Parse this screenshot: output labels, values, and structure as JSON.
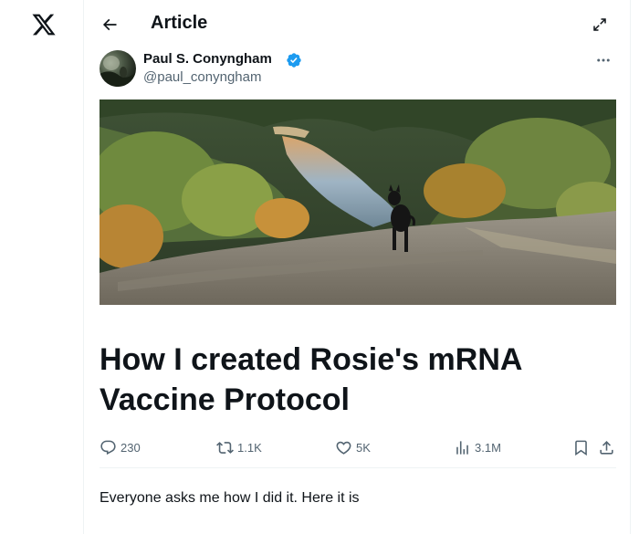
{
  "nav": {
    "logo_icon": "x-logo-icon"
  },
  "header": {
    "title": "Article",
    "back_icon": "arrow-left-icon",
    "expand_icon": "expand-icon"
  },
  "author": {
    "name": "Paul S. Conyngham",
    "handle": "@paul_conyngham",
    "verified": true,
    "verified_color": "#1d9bf0"
  },
  "hero_image": {
    "subject": "dog on rocky cliff overlooking river valley"
  },
  "article": {
    "title": "How I created Rosie's mRNA Vaccine Protocol",
    "body": "Everyone asks me how I did it. Here it is"
  },
  "stats": {
    "replies": "230",
    "reposts": "1.1K",
    "likes": "5K",
    "views": "3.1M"
  },
  "colors": {
    "text": "#0f1419",
    "muted": "#536471",
    "border": "#eff3f4",
    "accent": "#1d9bf0"
  }
}
